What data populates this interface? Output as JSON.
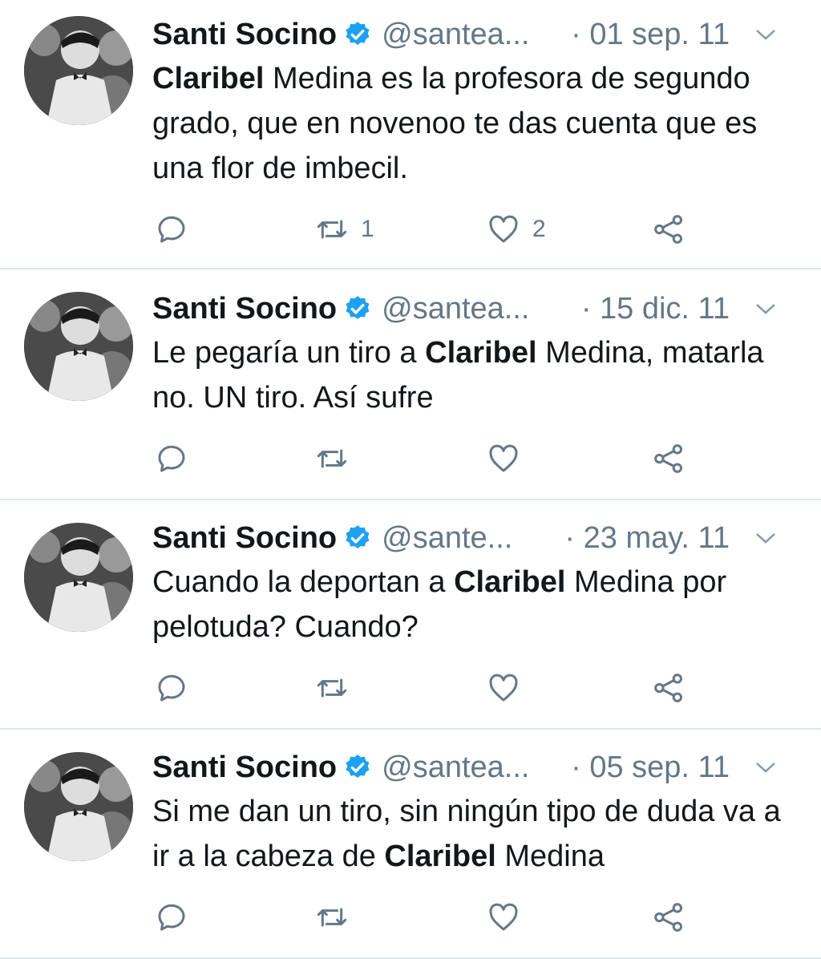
{
  "colors": {
    "text": "#14171a",
    "secondary": "#657786",
    "verified": "#1da1f2",
    "divider": "#e1e8ed"
  },
  "tweets": [
    {
      "name": "Santi Socino",
      "handle": "@santea...",
      "date": "· 01 sep. 11",
      "text_parts": [
        {
          "bold": true,
          "text": "Claribel"
        },
        {
          "bold": false,
          "text": " Medina es la profesora de segundo grado, que en novenoo te das cuenta que es una flor de imbecil."
        }
      ],
      "retweets": "1",
      "likes": "2"
    },
    {
      "name": "Santi Socino",
      "handle": "@santea...",
      "date": "· 15 dic. 11",
      "text_parts": [
        {
          "bold": false,
          "text": "Le pegaría un tiro a "
        },
        {
          "bold": true,
          "text": "Claribel"
        },
        {
          "bold": false,
          "text": " Medina, matarla no. UN tiro. Así sufre"
        }
      ],
      "retweets": "",
      "likes": ""
    },
    {
      "name": "Santi Socino",
      "handle": "@sante...",
      "date": "· 23 may. 11",
      "text_parts": [
        {
          "bold": false,
          "text": "Cuando la deportan a "
        },
        {
          "bold": true,
          "text": "Claribel"
        },
        {
          "bold": false,
          "text": " Medina por pelotuda? Cuando?"
        }
      ],
      "retweets": "",
      "likes": ""
    },
    {
      "name": "Santi Socino",
      "handle": "@santea...",
      "date": "· 05 sep. 11",
      "text_parts": [
        {
          "bold": false,
          "text": "Si me dan un tiro, sin ningún tipo de duda va a ir a la cabeza de "
        },
        {
          "bold": true,
          "text": "Claribel"
        },
        {
          "bold": false,
          "text": " Medina"
        }
      ],
      "retweets": "",
      "likes": ""
    }
  ],
  "icons": {
    "avatar": "profile-photo",
    "verified": "verified-badge-icon",
    "caret": "chevron-down-icon",
    "reply": "reply-icon",
    "retweet": "retweet-icon",
    "like": "heart-icon",
    "share": "share-icon"
  }
}
